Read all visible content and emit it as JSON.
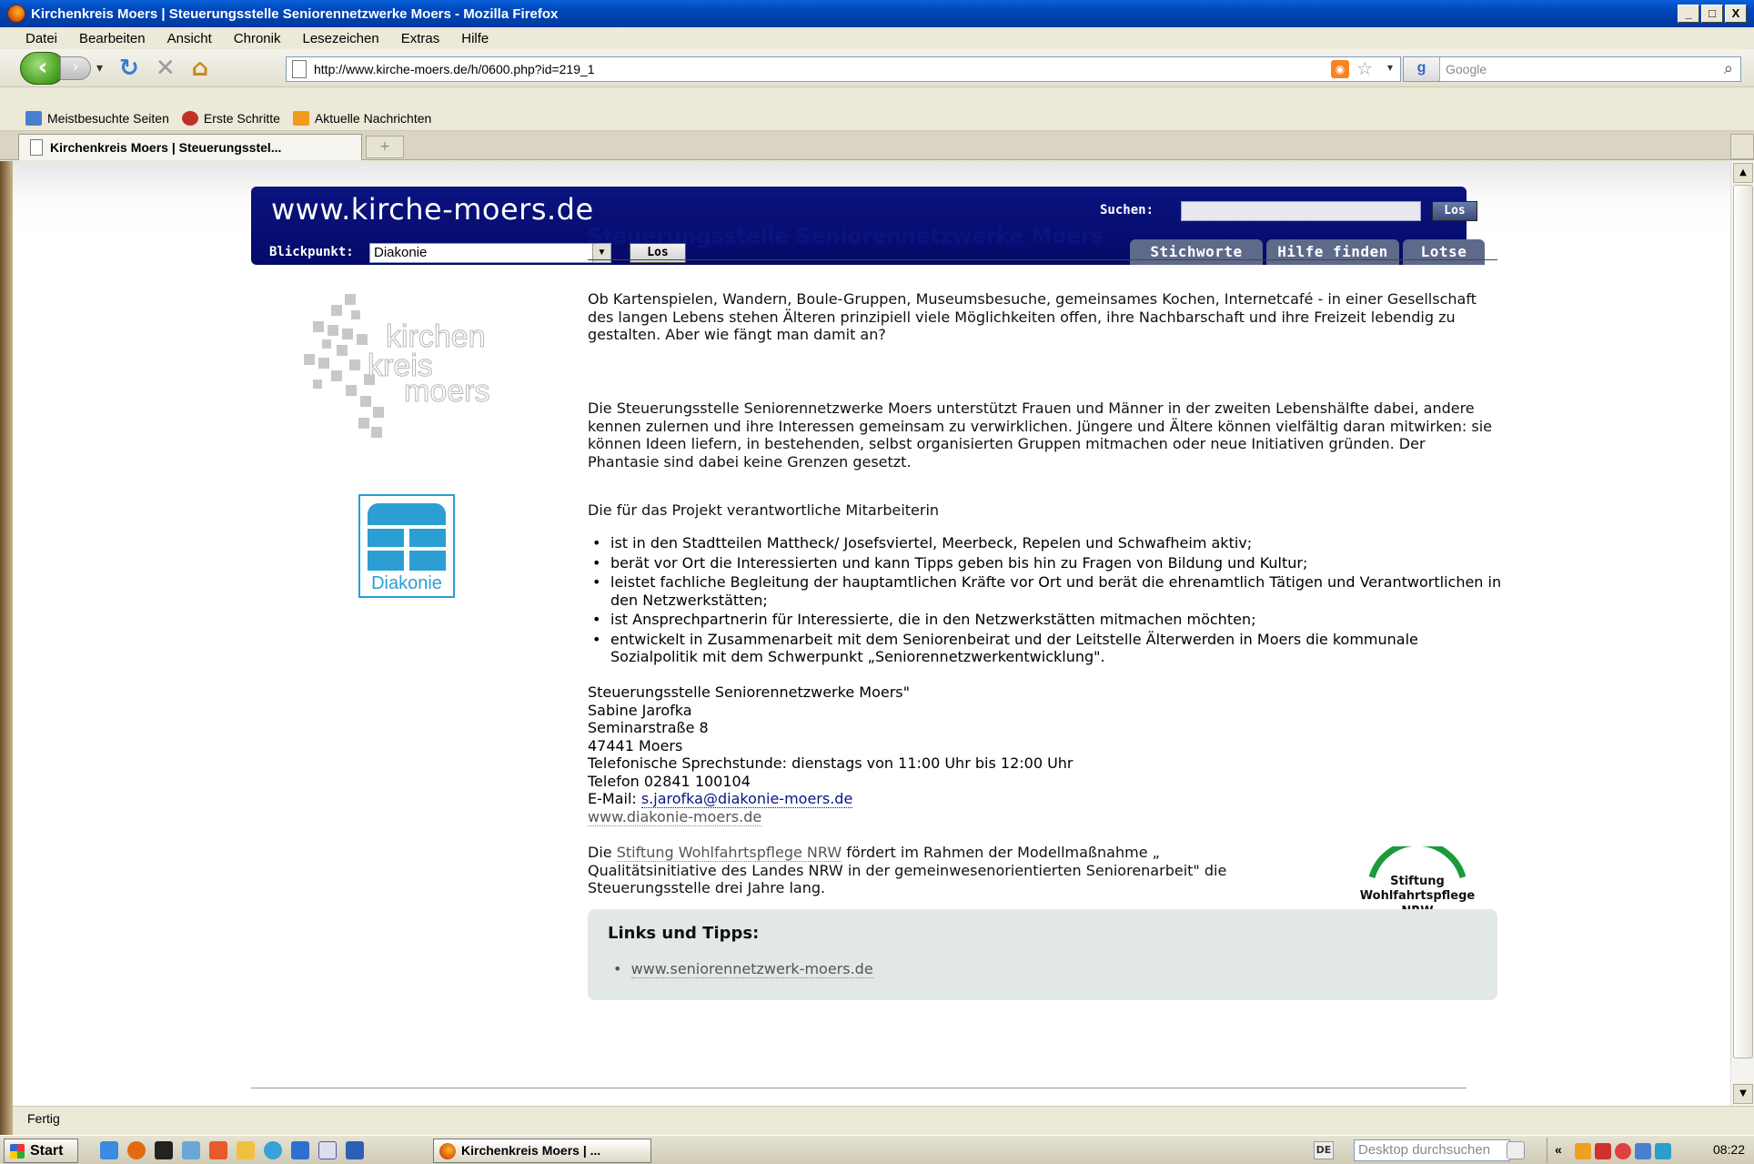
{
  "window": {
    "title": "Kirchenkreis Moers | Steuerungsstelle Seniorennetzwerke Moers - Mozilla Firefox",
    "buttons": [
      "_",
      "□",
      "X"
    ]
  },
  "menu": [
    "Datei",
    "Bearbeiten",
    "Ansicht",
    "Chronik",
    "Lesezeichen",
    "Extras",
    "Hilfe"
  ],
  "navbar": {
    "url": "http://www.kirche-moers.de/h/0600.php?id=219_1",
    "search_placeholder": "Google"
  },
  "bookmarks": [
    {
      "label": "Meistbesuchte Seiten",
      "color": "#4a7fd0"
    },
    {
      "label": "Erste Schritte",
      "color": "#c0302a"
    },
    {
      "label": "Aktuelle Nachrichten",
      "color": "#f39a1c"
    }
  ],
  "tab": {
    "label": "Kirchenkreis Moers | Steuerungsstel...",
    "new_tab": "+"
  },
  "site": {
    "logo": "www.kirche-moers.de",
    "search_label": "Suchen:",
    "search_button": "Los",
    "blickpunkt_label": "Blickpunkt:",
    "blickpunkt_value": "Diakonie",
    "blickpunkt_button": "Los",
    "nav_tabs": [
      "Stichworte",
      "Hilfe finden",
      "Lotse"
    ],
    "kk_logo_text": [
      "kirchen",
      "kreis",
      "moers"
    ],
    "diakonie_text": "Diakonie"
  },
  "article": {
    "title": "Steuerungsstelle Seniorennetzwerke Moers",
    "p1": "Ob Kartenspielen, Wandern, Boule-Gruppen, Museumsbesuche, gemeinsames Kochen, Internetcafé - in einer Gesellschaft des langen Lebens stehen Älteren prinzipiell viele Möglichkeiten offen, ihre Nachbarschaft und ihre Freizeit lebendig zu gestalten. Aber wie fängt man damit an?",
    "p2": "Die Steuerungsstelle Seniorennetzwerke Moers unterstützt Frauen und Männer in der zweiten Lebenshälfte dabei, andere kennen zulernen und ihre Interessen gemeinsam zu verwirklichen. Jüngere und Ältere können vielfältig daran mitwirken: sie können Ideen liefern, in bestehenden, selbst organisierten Gruppen mitmachen oder neue Initiativen gründen. Der Phantasie sind dabei keine Grenzen gesetzt.",
    "p3": "Die für das Projekt verantwortliche Mitarbeiterin",
    "bullets": [
      "ist in den Stadtteilen Mattheck/ Josefsviertel, Meerbeck, Repelen und Schwafheim aktiv;",
      "berät vor Ort die Interessierten und kann Tipps geben bis hin zu Fragen von Bildung und Kultur;",
      "leistet fachliche Begleitung der hauptamtlichen Kräfte vor Ort und berät die ehrenamtlich Tätigen und Verantwortlichen in den Netzwerkstätten;",
      "ist Ansprechpartnerin für Interessierte, die in den Netzwerkstätten mitmachen möchten;",
      "entwickelt in Zusammenarbeit mit dem Seniorenbeirat und der Leitstelle Älterwerden in Moers die kommunale Sozialpolitik mit dem Schwerpunkt „Seniorennetzwerkentwicklung\"."
    ],
    "address": [
      "Steuerungsstelle Seniorennetzwerke Moers\"",
      "Sabine Jarofka",
      "Seminarstraße 8",
      "47441 Moers",
      "Telefonische Sprechstunde: dienstags von 11:00 Uhr bis 12:00 Uhr",
      "Telefon 02841 100104"
    ],
    "email_label": "E-Mail: ",
    "email": "s.jarofka@diakonie-moers.de",
    "web": "www.diakonie-moers.de",
    "funding_pre": "Die ",
    "funding_link": "Stiftung Wohlfahrtspflege NRW",
    "funding_post": " fördert im Rahmen der Modellmaßnahme „ Qualitätsinitiative des Landes NRW in der gemeinwesenorientierten Seniorenarbeit\" die Steuerungsstelle drei Jahre lang.",
    "stiftung_logo": [
      "Stiftung",
      "Wohlfahrtspflege",
      "NRW"
    ],
    "tips_title": "Links und Tipps:",
    "tips_link": "www.seniorennetzwerk-moers.de"
  },
  "status": "Fertig",
  "taskbar": {
    "start": "Start",
    "task": "Kirchenkreis Moers | ...",
    "lang": "DE",
    "desktop_search": "Desktop durchsuchen",
    "clock": "08:22",
    "tray_chevron": "«"
  }
}
